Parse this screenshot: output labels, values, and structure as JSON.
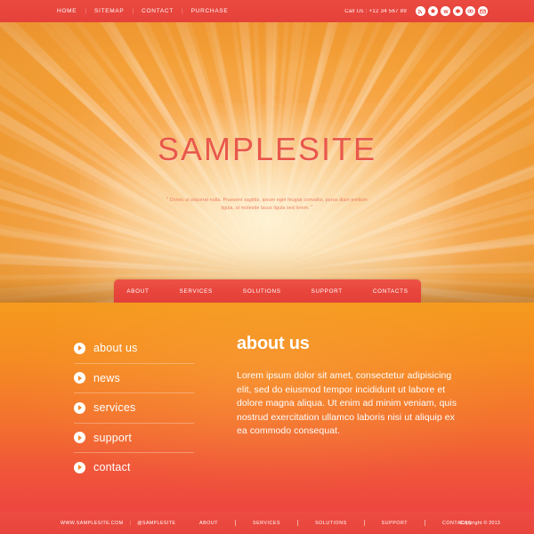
{
  "topbar": {
    "nav": [
      {
        "label": "HOME"
      },
      {
        "label": "SITEMAP"
      },
      {
        "label": "CONTACT"
      },
      {
        "label": "PURCHASE"
      }
    ],
    "separator": "|",
    "call_us": "Call Us : +12 34 567 89",
    "socials": [
      {
        "name": "rss-icon",
        "glyph": "◉"
      },
      {
        "name": "star-icon",
        "glyph": "★"
      },
      {
        "name": "wordpress-icon",
        "glyph": "W"
      },
      {
        "name": "share-icon",
        "glyph": "❖"
      },
      {
        "name": "flickr-icon",
        "glyph": "∞"
      },
      {
        "name": "email-icon",
        "glyph": "✉"
      }
    ]
  },
  "hero": {
    "title": "SAMPLESITE",
    "quote_open": "“",
    "quote_close": "”",
    "quote": "Donec ut placerat nulla. Praesent sagittis, ipsum eget feugiat convallis, purus diam pretium ligula, ut molestie lacus ligula sed lorem.",
    "background_color": "#f7a33f",
    "center_glow_color": "#fbe0b4",
    "title_color": "#e9584b"
  },
  "mainnav": {
    "background_color": "#e8453c",
    "items": [
      {
        "label": "ABOUT"
      },
      {
        "label": "SERVICES"
      },
      {
        "label": "SOLUTIONS"
      },
      {
        "label": "SUPPORT"
      },
      {
        "label": "CONTACTS"
      }
    ]
  },
  "sidemenu": {
    "items": [
      {
        "label": "about us",
        "icon": "play-arrow-icon"
      },
      {
        "label": "news",
        "icon": "play-arrow-icon"
      },
      {
        "label": "services",
        "icon": "play-arrow-icon"
      },
      {
        "label": "support",
        "icon": "play-arrow-icon"
      },
      {
        "label": "contact",
        "icon": "play-arrow-icon"
      }
    ]
  },
  "article": {
    "heading": "about us",
    "body": "Lorem ipsum dolor sit amet, consectetur adipisicing elit, sed do eiusmod tempor incididunt ut labore et dolore magna aliqua. Ut enim ad minim veniam, quis nostrud exercitation ullamco laboris nisi ut aliquip ex ea commodo consequat."
  },
  "content": {
    "gradient_top": "#f59a1e",
    "gradient_bottom": "#ee4540"
  },
  "footer": {
    "background_color": "#e8453c",
    "website": "WWW.SAMPLESITE.COM",
    "separator": "|",
    "handle": "@SAMPLESITE",
    "nav": [
      {
        "label": "ABOUT"
      },
      {
        "label": "SERVICES"
      },
      {
        "label": "SOLUTIONS"
      },
      {
        "label": "SUPPORT"
      },
      {
        "label": "CONTACTS"
      }
    ],
    "copyright": "Copyright © 2013"
  }
}
